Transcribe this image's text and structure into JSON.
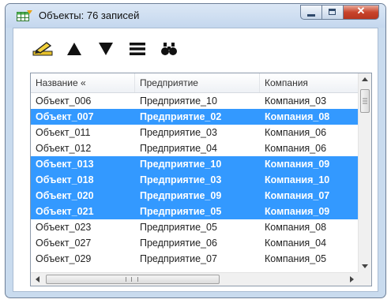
{
  "window": {
    "title": "Объекты: 76 записей",
    "icon": "table-grid-icon"
  },
  "titlebar_buttons": [
    "minimize-icon",
    "maximize-icon",
    "close-icon"
  ],
  "toolbar": {
    "buttons": [
      "pencil-edit-icon",
      "arrow-up-icon",
      "arrow-down-icon",
      "list-lines-icon",
      "binoculars-icon"
    ]
  },
  "grid": {
    "columns": [
      "Название «",
      "Предприятие",
      "Компания"
    ],
    "rows": [
      {
        "name": "Объект_006",
        "enterprise": "Предприятие_10",
        "company": "Компания_03",
        "selected": false
      },
      {
        "name": "Объект_007",
        "enterprise": "Предприятие_02",
        "company": "Компания_08",
        "selected": true
      },
      {
        "name": "Объект_011",
        "enterprise": "Предприятие_03",
        "company": "Компания_06",
        "selected": false
      },
      {
        "name": "Объект_012",
        "enterprise": "Предприятие_04",
        "company": "Компания_06",
        "selected": false
      },
      {
        "name": "Объект_013",
        "enterprise": "Предприятие_10",
        "company": "Компания_09",
        "selected": true
      },
      {
        "name": "Объект_018",
        "enterprise": "Предприятие_03",
        "company": "Компания_10",
        "selected": true
      },
      {
        "name": "Объект_020",
        "enterprise": "Предприятие_09",
        "company": "Компания_07",
        "selected": true
      },
      {
        "name": "Объект_021",
        "enterprise": "Предприятие_05",
        "company": "Компания_09",
        "selected": true
      },
      {
        "name": "Объект_023",
        "enterprise": "Предприятие_05",
        "company": "Компания_08",
        "selected": false
      },
      {
        "name": "Объект_027",
        "enterprise": "Предприятие_06",
        "company": "Компания_04",
        "selected": false
      },
      {
        "name": "Объект_029",
        "enterprise": "Предприятие_07",
        "company": "Компания_05",
        "selected": false
      }
    ]
  },
  "colors": {
    "selection": "#3399ff",
    "selection_text": "#ffffff",
    "frame": "#c9dbee",
    "close_button": "#c8442b"
  }
}
